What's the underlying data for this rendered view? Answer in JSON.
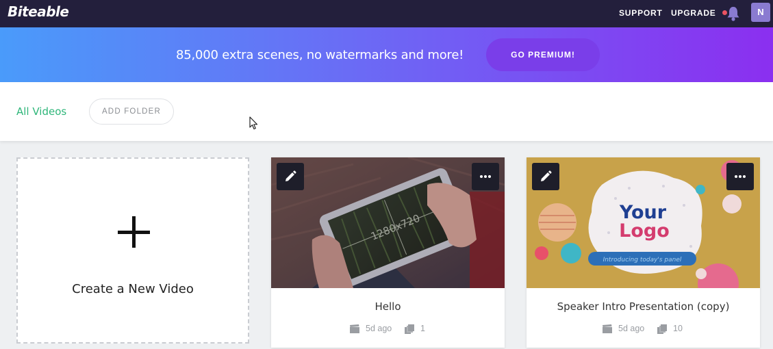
{
  "topbar": {
    "logo": "Biteable",
    "support_label": "SUPPORT",
    "upgrade_label": "UPGRADE",
    "notification_icon": "bell-icon",
    "avatar_initial": "N"
  },
  "banner": {
    "text": "85,000 extra scenes, no watermarks and more!",
    "cta_label": "GO PREMIUM!"
  },
  "toolbar": {
    "all_videos_label": "All Videos",
    "add_folder_label": "ADD FOLDER"
  },
  "create_card": {
    "label": "Create a New Video",
    "icon": "plus-icon"
  },
  "videos": [
    {
      "title": "Hello",
      "age": "5d ago",
      "scenes": "1",
      "thumbnail_text": "1280x720"
    },
    {
      "title": "Speaker Intro Presentation (copy)",
      "age": "5d ago",
      "scenes": "10",
      "thumbnail_text": {
        "line1": "Your",
        "line2": "Logo",
        "tagline": "Introducing today's panel"
      }
    }
  ],
  "colors": {
    "topbar_bg": "#231f3c",
    "accent_green": "#2fb67a",
    "banner_start": "#4a9bfa",
    "banner_end": "#8b2ff0",
    "premium_button": "#7a3ee9"
  }
}
